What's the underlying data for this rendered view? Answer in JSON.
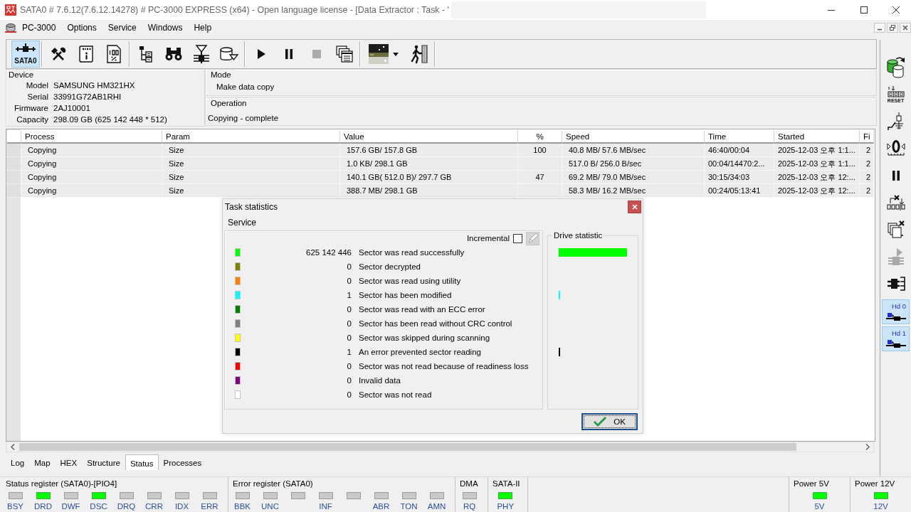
{
  "window": {
    "title": "SATA0 # 7.6.12(7.6.12.14278) # PC-3000 EXPRESS (x64) - Open language license - [Data Extractor : Task - '"
  },
  "menu": {
    "items": [
      "PC-3000",
      "Options",
      "Service",
      "Windows",
      "Help"
    ]
  },
  "toolbar": {
    "port_button": {
      "label": "SATA0",
      "selected": true
    },
    "groups": [
      [
        {
          "kind": "tools",
          "disabled": false
        },
        {
          "kind": "scroll",
          "disabled": false
        },
        {
          "kind": "percent",
          "disabled": false
        }
      ],
      [
        {
          "kind": "tree",
          "disabled": false
        },
        {
          "kind": "binoculars",
          "disabled": false
        },
        {
          "kind": "funnel",
          "disabled": false
        },
        {
          "kind": "drive",
          "disabled": false
        }
      ],
      [
        {
          "kind": "play",
          "disabled": false
        },
        {
          "kind": "pause",
          "disabled": false
        },
        {
          "kind": "stop",
          "disabled": true
        },
        {
          "kind": "windows",
          "disabled": false
        }
      ],
      [
        {
          "kind": "thumbnail",
          "disabled": false
        },
        {
          "kind": "exit",
          "disabled": false
        }
      ]
    ]
  },
  "side_toolbar": {
    "buttons": [
      {
        "kind": "copy",
        "disabled": false
      },
      {
        "kind": "reset",
        "label": "RESET",
        "disabled": false
      },
      {
        "kind": "switch",
        "disabled": false
      },
      {
        "kind": "zero",
        "disabled": false
      },
      {
        "kind": "pause",
        "disabled": false
      },
      {
        "kind": "counter",
        "disabled": false
      },
      {
        "kind": "stack",
        "disabled": false
      },
      {
        "kind": "forward",
        "disabled": true
      },
      {
        "kind": "connector",
        "disabled": false
      }
    ],
    "heads": [
      {
        "label": "Hd 0",
        "selected": true
      },
      {
        "label": "Hd 1",
        "selected": true
      }
    ]
  },
  "device": {
    "title": "Device",
    "fields": [
      {
        "label": "Model",
        "value": "SAMSUNG HM321HX"
      },
      {
        "label": "Serial",
        "value": "33991G72AB1RHI"
      },
      {
        "label": "Firmware",
        "value": "2AJ10001"
      },
      {
        "label": "Capacity",
        "value": "298.09 GB (625 142 448 * 512)"
      }
    ]
  },
  "mode": {
    "title": "Mode",
    "value": "Make data copy"
  },
  "operation": {
    "title": "Operation",
    "value": "Copying - complete"
  },
  "table": {
    "columns": [
      "Process",
      "Param",
      "Value",
      "%",
      "Speed",
      "Time",
      "Started",
      "Fi"
    ],
    "rows": [
      {
        "process": "Copying",
        "param": "Size",
        "value": "157.6 GB/ 157.8 GB",
        "percent": "100",
        "speed": "40.8 MB/ 57.6 MB/sec",
        "time": "46:40/00:04",
        "started": "2025-12-03 오후 1:1...",
        "column_8": "2"
      },
      {
        "process": "Copying",
        "param": "Size",
        "value": "1.0 KB/ 298.1 GB",
        "speed": "517.0 B/ 256.0 B/sec",
        "time": "00:04/14470:2...",
        "started": "2025-12-03 오후 1:1...",
        "column_8": "2"
      },
      {
        "process": "Copying",
        "param": "Size",
        "value": "140.1 GB( 512.0 B)/ 297.7 GB",
        "percent": "47",
        "speed": "69.2 MB/ 79.0 MB/sec",
        "time": "30:15/34:03",
        "started": "2025-12-03 오후 12:...",
        "column_8": "2"
      },
      {
        "process": "Copying",
        "param": "Size",
        "value": "388.7 MB/ 298.1 GB",
        "speed": "58.3 MB/ 16.2 MB/sec",
        "time": "00:24/05:13:41",
        "started": "2025-12-03 오후 12:...",
        "column_8": "2"
      }
    ]
  },
  "dialog": {
    "title": "Task statistics",
    "menu": [
      "Service"
    ],
    "incremental": {
      "label": "Incremental",
      "checked": false
    },
    "edit_button": {
      "disabled": true
    },
    "rows": [
      {
        "color": "#00ff00",
        "count": "625 142 446",
        "label": "Sector was read successfully"
      },
      {
        "color": "#808000",
        "count": "0",
        "label": "Sector decrypted"
      },
      {
        "color": "#ff8000",
        "count": "0",
        "label": "Sector was read using utility"
      },
      {
        "color": "#00ffff",
        "count": "1",
        "label": "Sector has been modified"
      },
      {
        "color": "#008000",
        "count": "0",
        "label": "Sector was read with an ECC error"
      },
      {
        "color": "#808080",
        "count": "0",
        "label": "Sector has been read without CRC control"
      },
      {
        "color": "#ffff00",
        "count": "0",
        "label": "Sector was skipped during scanning"
      },
      {
        "color": "#000000",
        "count": "1",
        "label": "An error prevented sector reading"
      },
      {
        "color": "#ff0000",
        "count": "0",
        "label": "Sector was not read because of readiness loss"
      },
      {
        "color": "#800080",
        "count": "0",
        "label": "Invalid data"
      },
      {
        "color": "#ffffff",
        "count": "0",
        "label": "Sector was not read"
      }
    ],
    "drive_statistic": {
      "title": "Drive statistic"
    },
    "ok_button": {
      "label": "OK"
    }
  },
  "tabs": [
    {
      "label": "Log",
      "selected": false
    },
    {
      "label": "Map",
      "selected": false
    },
    {
      "label": "HEX",
      "selected": false
    },
    {
      "label": "Structure",
      "selected": false
    },
    {
      "label": "Status",
      "selected": true
    },
    {
      "label": "Processes",
      "selected": false
    }
  ],
  "status_bar": {
    "groups": [
      {
        "kind": "register",
        "title": "Status register (SATA0)-[PIO4]",
        "leds": [
          {
            "label": "BSY",
            "on": false
          },
          {
            "label": "DRD",
            "on": true
          },
          {
            "label": "DWF",
            "on": false
          },
          {
            "label": "DSC",
            "on": true
          },
          {
            "label": "DRQ",
            "on": false
          },
          {
            "label": "CRR",
            "on": false
          },
          {
            "label": "IDX",
            "on": false
          },
          {
            "label": "ERR",
            "on": false
          }
        ]
      },
      {
        "kind": "register",
        "title": "Error register (SATA0)",
        "leds": [
          {
            "label": "BBK",
            "on": false
          },
          {
            "label": "UNC",
            "on": false
          },
          {
            "on": false
          },
          {
            "label": "INF",
            "on": false
          },
          {
            "on": false
          },
          {
            "label": "ABR",
            "on": false
          },
          {
            "label": "TON",
            "on": false
          },
          {
            "label": "AMN",
            "on": false
          }
        ]
      },
      {
        "kind": "register",
        "title": "DMA",
        "leds": [
          {
            "label": "RQ",
            "on": false
          }
        ]
      },
      {
        "kind": "register",
        "title": "SATA-II",
        "leds": [
          {
            "label": "PHY",
            "on": true
          }
        ]
      },
      {
        "kind": "power",
        "title": "Power 5V",
        "leds": [
          {
            "label": "5V",
            "on": true
          }
        ]
      },
      {
        "kind": "power",
        "title": "Power 12V",
        "leds": [
          {
            "label": "12V",
            "on": true
          }
        ]
      }
    ]
  }
}
